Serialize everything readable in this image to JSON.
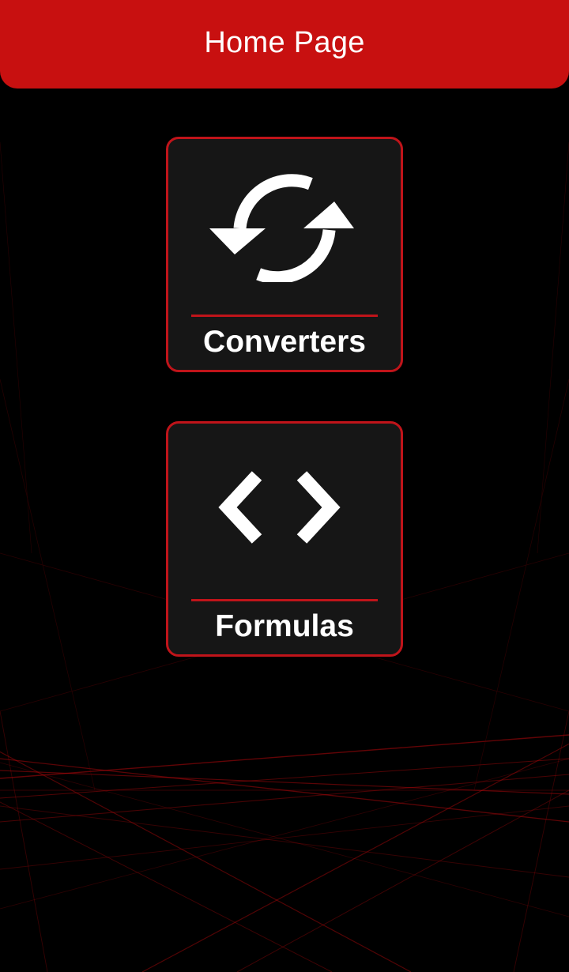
{
  "header": {
    "title": "Home Page"
  },
  "cards": [
    {
      "label": "Converters",
      "icon": "sync-icon"
    },
    {
      "label": "Formulas",
      "icon": "code-brackets-icon"
    }
  ],
  "colors": {
    "accent": "#c81010",
    "card_border": "#c0141a",
    "card_background": "#161616",
    "background": "#000000",
    "text": "#ffffff"
  }
}
